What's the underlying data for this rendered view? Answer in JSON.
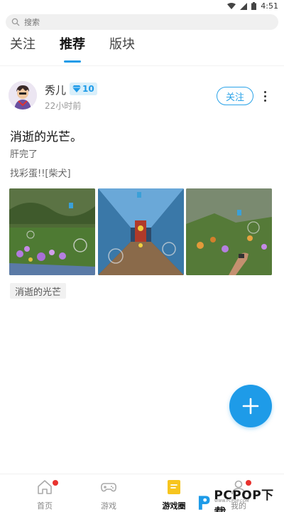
{
  "status_bar": {
    "time": "4:51"
  },
  "search": {
    "placeholder": "搜索"
  },
  "tabs": [
    {
      "label": "关注",
      "active": false
    },
    {
      "label": "推荐",
      "active": true
    },
    {
      "label": "版块",
      "active": false
    }
  ],
  "post": {
    "username": "秀儿",
    "level": "10",
    "time": "22小时前",
    "follow_label": "关注",
    "title": "消逝的光芒。",
    "body": "肝完了",
    "line2": "找彩蛋!![柴犬]",
    "topic_tag": "消逝的光芒",
    "images": [
      "game-screenshot-garden",
      "game-screenshot-corridor",
      "game-screenshot-first-person"
    ]
  },
  "bottom_nav": [
    {
      "label": "首页",
      "icon": "home-icon",
      "active": false,
      "badge": true
    },
    {
      "label": "游戏",
      "icon": "gamepad-icon",
      "active": false,
      "badge": false
    },
    {
      "label": "游戏圈",
      "icon": "notebook-icon",
      "active": true,
      "badge": false
    },
    {
      "label": "我的",
      "icon": "user-icon",
      "active": false,
      "badge": true
    }
  ],
  "watermark": {
    "text": "PCPOP下载",
    "sub": "WWW.PCPOP.COM"
  },
  "colors": {
    "accent": "#1e9be8",
    "badge": "#e8322e",
    "active_nav": "#f7c51e"
  }
}
